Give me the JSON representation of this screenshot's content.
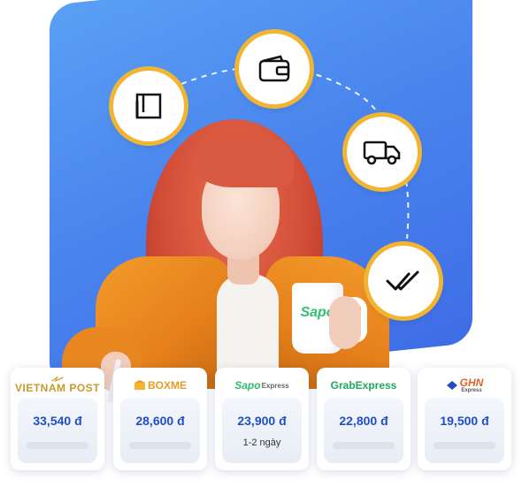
{
  "steps": [
    {
      "icon": "box-icon"
    },
    {
      "icon": "wallet-icon"
    },
    {
      "icon": "truck-icon"
    },
    {
      "icon": "double-check-icon"
    }
  ],
  "mug_brand": "Sapo",
  "carriers": [
    {
      "name": "VIETNAM POST",
      "price": "33,540 đ",
      "eta": ""
    },
    {
      "name": "BOXME",
      "price": "28,600 đ",
      "eta": ""
    },
    {
      "name": "Sapo",
      "sub": "Express",
      "price": "23,900 đ",
      "eta": "1-2 ngày"
    },
    {
      "name": "GrabExpress",
      "price": "22,800 đ",
      "eta": ""
    },
    {
      "name": "GHN",
      "sub": "Express",
      "price": "19,500 đ",
      "eta": ""
    }
  ],
  "colors": {
    "accent_blue": "#3e6de6",
    "ring_gold": "#f2b531",
    "price_blue": "#1f4fc8"
  }
}
